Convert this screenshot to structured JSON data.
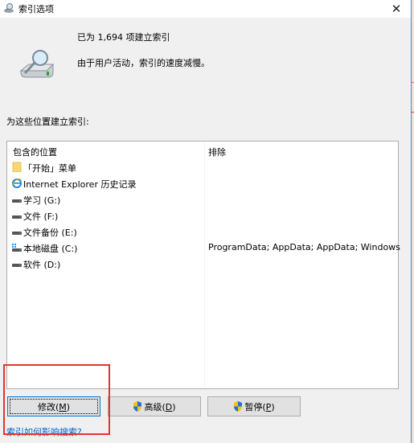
{
  "window": {
    "title": "索引选项",
    "close_label": "✕"
  },
  "status": {
    "indexed_count_text": "已为 1,694 项建立索引",
    "message": "由于用户活动，索引的速度减慢。"
  },
  "index_label": "为这些位置建立索引:",
  "list": {
    "headers": {
      "included": "包含的位置",
      "excluded": "排除"
    },
    "rows": [
      {
        "icon": "folder-icon",
        "location": "「开始」菜单",
        "exclude": ""
      },
      {
        "icon": "internet-explorer-icon",
        "location": "Internet Explorer 历史记录",
        "exclude": ""
      },
      {
        "icon": "drive-icon",
        "location": "学习 (G:)",
        "exclude": ""
      },
      {
        "icon": "drive-icon",
        "location": "文件 (F:)",
        "exclude": ""
      },
      {
        "icon": "drive-icon",
        "location": "文件备份 (E:)",
        "exclude": ""
      },
      {
        "icon": "system-drive-icon",
        "location": "本地磁盘 (C:)",
        "exclude": "ProgramData; AppData; AppData; Windows"
      },
      {
        "icon": "drive-icon",
        "location": "软件 (D:)",
        "exclude": ""
      }
    ]
  },
  "buttons": {
    "modify": {
      "label": "修改(",
      "key": "M",
      "end": ")"
    },
    "advanced": {
      "label": "高级(",
      "key": "D",
      "end": ")"
    },
    "pause": {
      "label": "暂停(",
      "key": "P",
      "end": ")"
    }
  },
  "help_link": "索引如何影响搜索?",
  "colors": {
    "accent": "#0078d7",
    "link": "#0066cc",
    "highlight": "#e53333"
  }
}
